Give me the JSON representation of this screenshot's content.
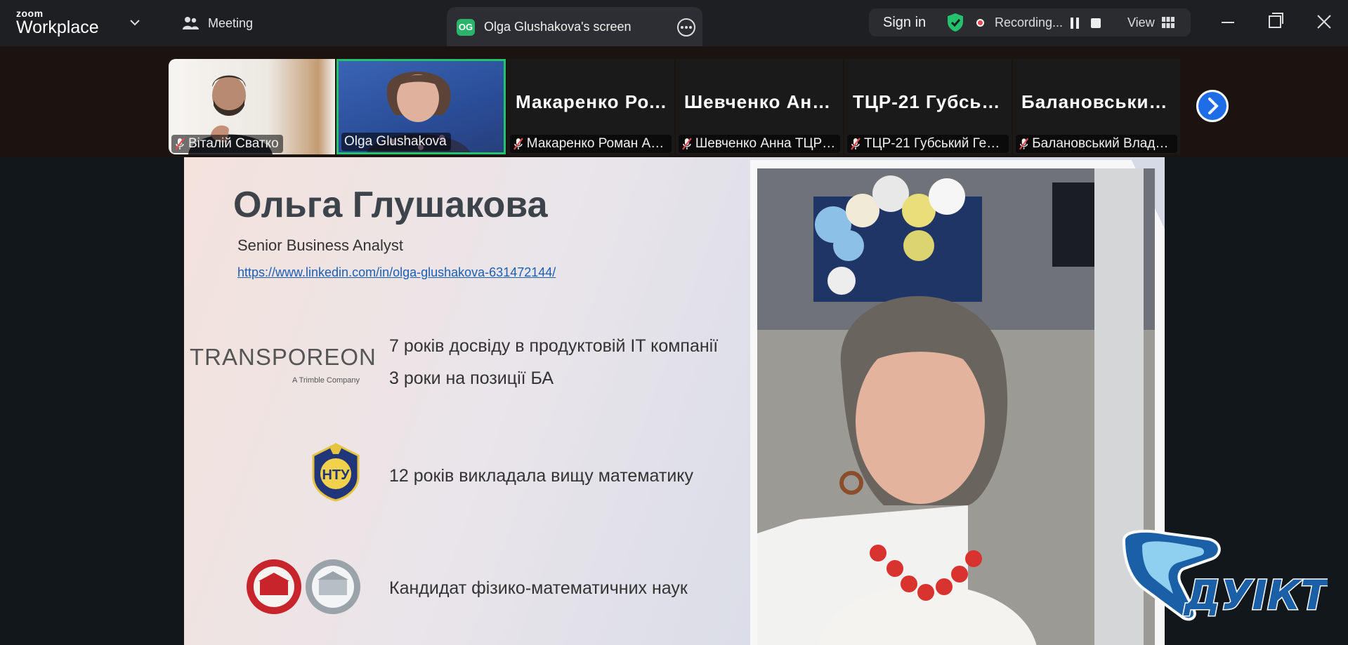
{
  "app": {
    "brand_small": "zoom",
    "brand_big": "Workplace",
    "meeting_label": "Meeting",
    "share_tab": {
      "initials": "OG",
      "label": "Olga Glushakova's screen"
    },
    "signin_label": "Sign in",
    "recording_label": "Recording...",
    "view_label": "View"
  },
  "participants": [
    {
      "name": "Віталій Сватко",
      "type": "video",
      "muted": true
    },
    {
      "name": "Olga Glushakova",
      "type": "video",
      "muted": false,
      "active": true
    },
    {
      "big_name": "Макаренко Ро...",
      "name": "Макаренко Роман Ан...",
      "type": "name",
      "muted": true
    },
    {
      "big_name": "Шевченко Анн...",
      "name": "Шевченко Анна ТЦР-...",
      "type": "name",
      "muted": true
    },
    {
      "big_name": "ТЦР-21 Губськ...",
      "name": "ТЦР-21 Губський Гео...",
      "type": "name",
      "muted": true
    },
    {
      "big_name": "Балановський...",
      "name": "Балановський Владис...",
      "type": "name",
      "muted": true
    }
  ],
  "slide": {
    "name": "Ольга Глушакова",
    "role": "Senior Business Analyst",
    "link": "https://www.linkedin.com/in/olga-glushakova-631472144/",
    "company_logo_text": "TRANSPOREON",
    "company_logo_sub": "A Trimble Company",
    "facts": [
      "7 років досвіду в продуктовій IT компанії",
      "3 роки на позиції БА",
      "12 років викладала вищу математику",
      "Кандидат фізико-математичних наук"
    ],
    "univ_logo_text": "НТУ",
    "watermark_text": "ДУІКТ"
  },
  "colors": {
    "accent_green": "#24c26d",
    "brand_blue": "#1d6de6",
    "record_red": "#e8484f",
    "link_blue": "#1a5fb4"
  }
}
